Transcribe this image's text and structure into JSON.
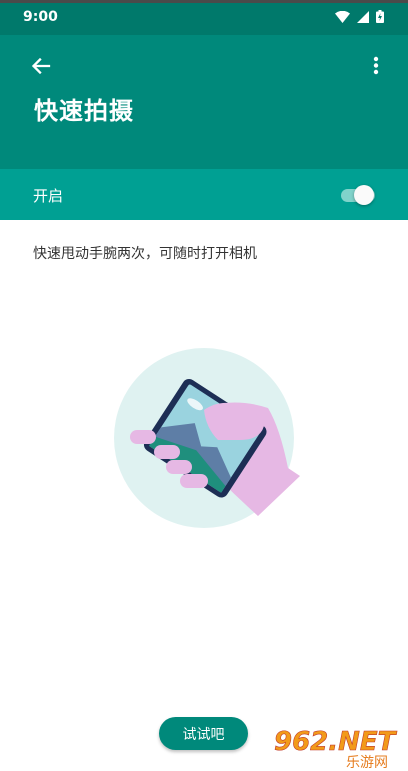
{
  "status_bar": {
    "time": "9:00",
    "icons": [
      "wifi-icon",
      "cell-signal-icon",
      "battery-icon"
    ]
  },
  "app_bar": {
    "back_icon": "arrow-back-icon",
    "more_icon": "more-vert-icon",
    "title": "快速拍摄"
  },
  "setting": {
    "label": "开启",
    "enabled": true
  },
  "description": "快速甩动手腕两次，可随时打开相机",
  "illustration": {
    "icon": "hand-holding-phone-illustration"
  },
  "try_button": {
    "label": "试试吧"
  },
  "watermark": {
    "text": "962.NET",
    "subtext": "乐游网"
  },
  "colors": {
    "status_bar": "#00796b",
    "app_bar": "#00897b",
    "toggle_row": "#00a093",
    "accent": "#00897b"
  }
}
